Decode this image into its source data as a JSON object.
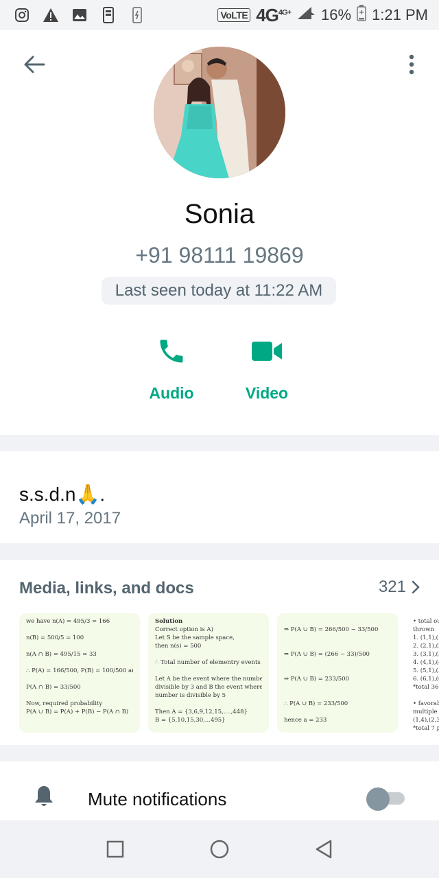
{
  "status_bar": {
    "network": "VoLTE",
    "net_type": "4G",
    "net_sup": "4G+",
    "battery": "16%",
    "time": "1:21 PM"
  },
  "contact": {
    "name": "Sonia",
    "phone": "+91 98111 19869",
    "last_seen": "Last seen today at 11:22 AM"
  },
  "actions": {
    "audio_label": "Audio",
    "video_label": "Video"
  },
  "about": {
    "text": "s.s.d.n🙏.",
    "date": "April 17, 2017"
  },
  "media": {
    "title": "Media, links, and docs",
    "count": "321",
    "thumbs": [
      {
        "lines": [
          "we have n(A) = 495/3 = 166",
          "n(B) = 500/5 = 100",
          "n(A ∩ B) = 495/15 = 33",
          "∴ P(A) = 166/500, P(B) = 100/500 and",
          "P(A ∩ B) = 33/500",
          "Now, required probability",
          "P(A ∪ B) = P(A) + P(B) − P(A ∩ B)"
        ]
      },
      {
        "lines": [
          "Solution",
          "Correct option is A)",
          "Let S be the sample space,",
          "then n(s) = 500",
          "∴ Total number of elementry events = 500",
          "Let A be the event where the number is",
          "divisible by 3 and B the event where the",
          "number is divisible by 5",
          "Then A = {3,6,9,12,15,....,448}",
          "B = {5,10,15,30,...495}"
        ]
      },
      {
        "lines": [
          "⇒ P(A ∪ B) = 266/500 − 33/500",
          "⇒ P(A ∪ B) = (266 − 33)/500",
          "⇒ P(A ∪ B) = 233/500",
          "∴ P(A ∪ B) = 233/500",
          "hence a = 233"
        ]
      },
      {
        "lines": [
          "• total ou",
          "thrown",
          "1. (1,1),(1,2),",
          "2. (2,1),(2,2",
          "3. (3,1),(3,2",
          "4. (4,1),(4,2",
          "5. (5,1),(5,2",
          "6. (6,1),(6,2",
          "*total 36 p",
          "• favorab",
          "multiple",
          "(1,4),(2,3),(",
          "*total 7 p"
        ]
      }
    ]
  },
  "mute": {
    "label": "Mute notifications",
    "enabled": false
  },
  "colors": {
    "accent": "#00a884",
    "secondary_text": "#667781",
    "background": "#f0f2f5"
  }
}
